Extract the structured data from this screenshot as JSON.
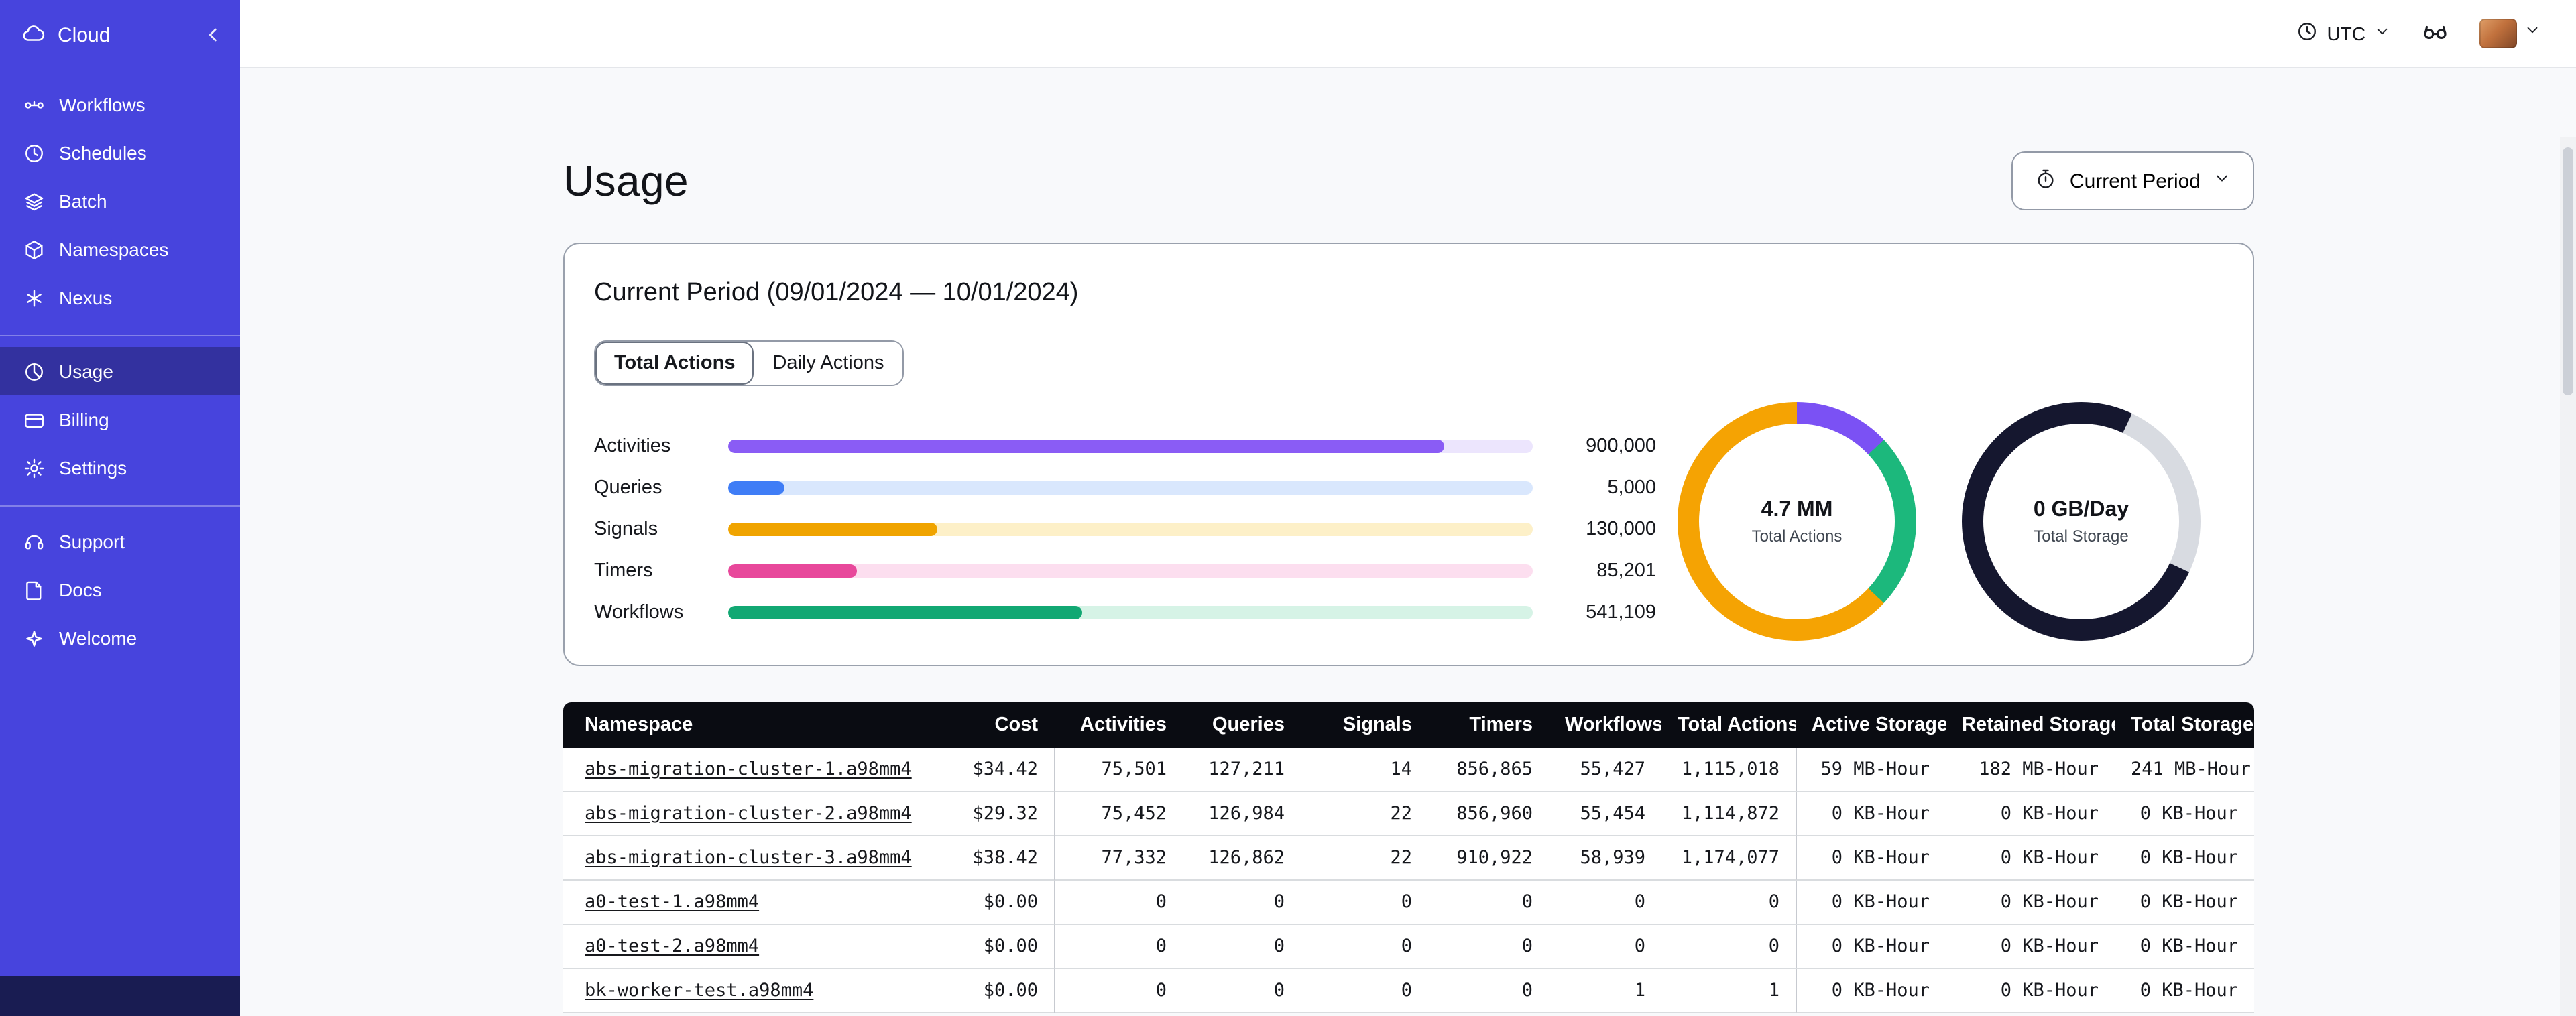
{
  "sidebar": {
    "brand_label": "Cloud",
    "nav_main": [
      {
        "label": "Workflows",
        "icon": "workflows-icon"
      },
      {
        "label": "Schedules",
        "icon": "schedules-icon"
      },
      {
        "label": "Batch",
        "icon": "batch-icon"
      },
      {
        "label": "Namespaces",
        "icon": "namespaces-icon"
      },
      {
        "label": "Nexus",
        "icon": "nexus-icon"
      }
    ],
    "nav_account": [
      {
        "label": "Usage",
        "icon": "usage-icon",
        "active": true
      },
      {
        "label": "Billing",
        "icon": "billing-icon",
        "active": false
      },
      {
        "label": "Settings",
        "icon": "settings-icon",
        "active": false
      }
    ],
    "nav_help": [
      {
        "label": "Support",
        "icon": "support-icon"
      },
      {
        "label": "Docs",
        "icon": "docs-icon"
      },
      {
        "label": "Welcome",
        "icon": "welcome-icon"
      }
    ]
  },
  "topbar": {
    "timezone": "UTC"
  },
  "page": {
    "title": "Usage",
    "period_button_label": "Current Period",
    "card_title": "Current Period (09/01/2024 — 10/01/2024)",
    "tabs": [
      {
        "label": "Total Actions",
        "active": true
      },
      {
        "label": "Daily Actions",
        "active": false
      }
    ]
  },
  "chart_data": [
    {
      "type": "bar",
      "orientation": "horizontal",
      "categories": [
        "Activities",
        "Queries",
        "Signals",
        "Timers",
        "Workflows"
      ],
      "values": [
        900000,
        5000,
        130000,
        85201,
        541109
      ],
      "bars": [
        {
          "label": "Activities",
          "value": 900000,
          "value_label": "900,000",
          "fill_percent": 89,
          "color": "#8a5cf5",
          "track_color": "#ece5fd"
        },
        {
          "label": "Queries",
          "value": 5000,
          "value_label": "5,000",
          "fill_percent": 7,
          "color": "#3f7df6",
          "track_color": "#d9e7fd"
        },
        {
          "label": "Signals",
          "value": 130000,
          "value_label": "130,000",
          "fill_percent": 26,
          "color": "#f0a400",
          "track_color": "#fdf0c8"
        },
        {
          "label": "Timers",
          "value": 85201,
          "value_label": "85,201",
          "fill_percent": 16,
          "color": "#e8489b",
          "track_color": "#fcdeef"
        },
        {
          "label": "Workflows",
          "value": 541109,
          "value_label": "541,109",
          "fill_percent": 44,
          "color": "#12a873",
          "track_color": "#d6f3e6"
        }
      ]
    },
    {
      "type": "donut",
      "center_value": "4.7 MM",
      "center_label": "Total Actions",
      "segments": [
        {
          "name": "segment-purple",
          "color": "#7b51f4",
          "percent": 13
        },
        {
          "name": "segment-green",
          "color": "#1cb87c",
          "percent": 24
        },
        {
          "name": "segment-orange",
          "color": "#f5a303",
          "percent": 63
        }
      ]
    },
    {
      "type": "donut",
      "center_value": "0 GB/Day",
      "center_label": "Total Storage",
      "segments": [
        {
          "name": "segment-dark-top",
          "color": "#15172f",
          "percent": 7
        },
        {
          "name": "segment-light",
          "color": "#d8dbe1",
          "percent": 25
        },
        {
          "name": "segment-dark",
          "color": "#15172f",
          "percent": 68
        }
      ]
    }
  ],
  "table": {
    "headers": [
      "Namespace",
      "Cost",
      "Activities",
      "Queries",
      "Signals",
      "Timers",
      "Workflows",
      "Total Actions",
      "Active Storage",
      "Retained Storage",
      "Total Storage"
    ],
    "rows": [
      [
        "abs-migration-cluster-1.a98mm4",
        "$34.42",
        "75,501",
        "127,211",
        "14",
        "856,865",
        "55,427",
        "1,115,018",
        "59 MB-Hour",
        "182 MB-Hour",
        "241 MB-Hour"
      ],
      [
        "abs-migration-cluster-2.a98mm4",
        "$29.32",
        "75,452",
        "126,984",
        "22",
        "856,960",
        "55,454",
        "1,114,872",
        "0 KB-Hour",
        "0 KB-Hour",
        "0 KB-Hour"
      ],
      [
        "abs-migration-cluster-3.a98mm4",
        "$38.42",
        "77,332",
        "126,862",
        "22",
        "910,922",
        "58,939",
        "1,174,077",
        "0 KB-Hour",
        "0 KB-Hour",
        "0 KB-Hour"
      ],
      [
        "a0-test-1.a98mm4",
        "$0.00",
        "0",
        "0",
        "0",
        "0",
        "0",
        "0",
        "0 KB-Hour",
        "0 KB-Hour",
        "0 KB-Hour"
      ],
      [
        "a0-test-2.a98mm4",
        "$0.00",
        "0",
        "0",
        "0",
        "0",
        "0",
        "0",
        "0 KB-Hour",
        "0 KB-Hour",
        "0 KB-Hour"
      ],
      [
        "bk-worker-test.a98mm4",
        "$0.00",
        "0",
        "0",
        "0",
        "0",
        "1",
        "1",
        "0 KB-Hour",
        "0 KB-Hour",
        "0 KB-Hour"
      ]
    ]
  }
}
